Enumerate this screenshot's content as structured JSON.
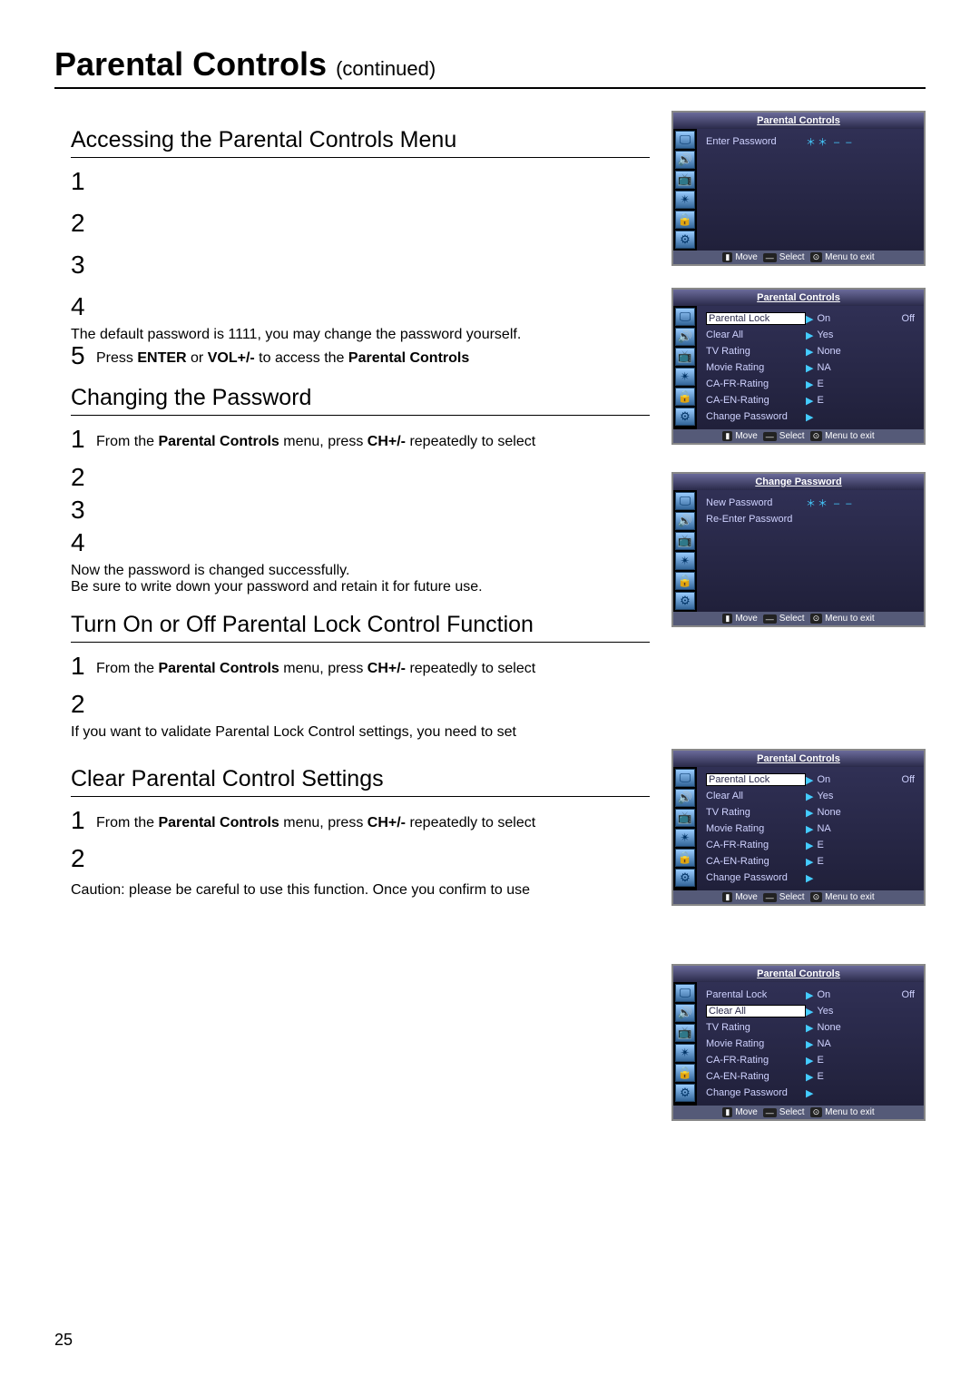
{
  "page": {
    "title": "Parental Controls",
    "continued": "(continued)",
    "number": "25"
  },
  "sections": {
    "access": {
      "heading": "Accessing the Parental Controls Menu",
      "steps": {
        "s1": "",
        "s2": "",
        "s3": "",
        "s4_note": "The default password is 1111, you may change the password yourself.",
        "s5_before": "Press ",
        "s5_b1": "ENTER",
        "s5_mid": " or ",
        "s5_b2": "VOL+/-",
        "s5_after": " to access the ",
        "s5_b3": "Parental Controls"
      }
    },
    "changepw": {
      "heading": "Changing the Password",
      "s1_before": "From the ",
      "s1_b1": "Parental Controls",
      "s1_mid": " menu, press ",
      "s1_b2": "CH+/-",
      "s1_after": " repeatedly to select",
      "note1": "Now the password is changed successfully.",
      "note2": "Be sure to write down your password and retain it for future use."
    },
    "lock": {
      "heading": "Turn On or Off Parental Lock Control Function",
      "s1_before": "From the ",
      "s1_b1": "Parental Controls",
      "s1_mid": " menu, press ",
      "s1_b2": "CH+/-",
      "s1_after": " repeatedly to select",
      "s2_note": "If you want to validate Parental Lock Control settings, you need to set"
    },
    "clear": {
      "heading": "Clear Parental Control Settings",
      "s1_before": "From the ",
      "s1_b1": "Parental Controls",
      "s1_mid": " menu, press ",
      "s1_b2": "CH+/-",
      "s1_after": " repeatedly to select",
      "caution_label": "Caution:",
      "caution_text": " please be careful to use this function. Once you confirm to use"
    }
  },
  "osd_common": {
    "footer_move": "Move",
    "footer_select": "Select",
    "footer_exit": "Menu to exit"
  },
  "osd1": {
    "title": "Parental Controls",
    "row1_label": "Enter Password",
    "row1_value": "＊＊ – –"
  },
  "osd2": {
    "title": "Parental Controls",
    "rows": [
      {
        "label": "Parental Lock",
        "val": "On",
        "right": "Off",
        "sel": true
      },
      {
        "label": "Clear All",
        "val": "Yes"
      },
      {
        "label": "TV Rating",
        "val": "None"
      },
      {
        "label": "Movie Rating",
        "val": "NA"
      },
      {
        "label": "CA-FR-Rating",
        "val": "E"
      },
      {
        "label": "CA-EN-Rating",
        "val": "E"
      },
      {
        "label": "Change Password",
        "val": ""
      }
    ]
  },
  "osd3": {
    "title": "Change Password",
    "row1_label": "New Password",
    "row1_value": "＊＊ – –",
    "row2_label": "Re-Enter Password"
  },
  "osd4": {
    "title": "Parental Controls",
    "rows": [
      {
        "label": "Parental Lock",
        "val": "On",
        "right": "Off",
        "sel": true
      },
      {
        "label": "Clear All",
        "val": "Yes"
      },
      {
        "label": "TV Rating",
        "val": "None"
      },
      {
        "label": "Movie Rating",
        "val": "NA"
      },
      {
        "label": "CA-FR-Rating",
        "val": "E"
      },
      {
        "label": "CA-EN-Rating",
        "val": "E"
      },
      {
        "label": "Change Password",
        "val": ""
      }
    ]
  },
  "osd5": {
    "title": "Parental Controls",
    "rows": [
      {
        "label": "Parental Lock",
        "val": "On",
        "right": "Off"
      },
      {
        "label": "Clear All",
        "val": "Yes",
        "sel": true
      },
      {
        "label": "TV Rating",
        "val": "None"
      },
      {
        "label": "Movie Rating",
        "val": "NA"
      },
      {
        "label": "CA-FR-Rating",
        "val": "E"
      },
      {
        "label": "CA-EN-Rating",
        "val": "E"
      },
      {
        "label": "Change Password",
        "val": ""
      }
    ]
  }
}
